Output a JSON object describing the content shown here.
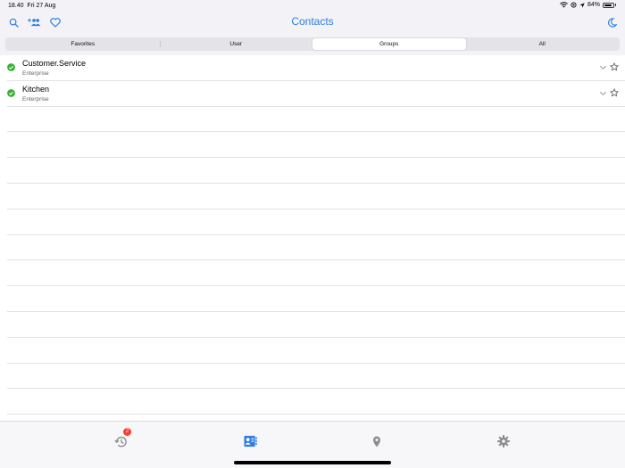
{
  "status": {
    "time": "18.40",
    "date": "Fri 27 Aug",
    "battery": "84%",
    "battery_level": 0.84
  },
  "nav": {
    "title": "Contacts"
  },
  "segments": [
    {
      "label": "Favorites",
      "active": false
    },
    {
      "label": "User",
      "active": false
    },
    {
      "label": "Groups",
      "active": true
    },
    {
      "label": "All",
      "active": false
    }
  ],
  "contacts": [
    {
      "name": "Customer.Service",
      "subtitle": "Enterprise"
    },
    {
      "name": "Kitchen",
      "subtitle": "Enterprise"
    }
  ],
  "tabs": {
    "recents_badge": "2"
  },
  "colors": {
    "accent": "#2f7ee0",
    "online": "#34b233",
    "badge": "#ff3b30"
  },
  "icons": [
    "search-icon",
    "add-group-icon",
    "heart-icon",
    "moon-icon",
    "check-circle-icon",
    "chevron-down-icon",
    "star-icon",
    "history-icon",
    "contacts-icon",
    "location-icon",
    "gear-icon"
  ]
}
